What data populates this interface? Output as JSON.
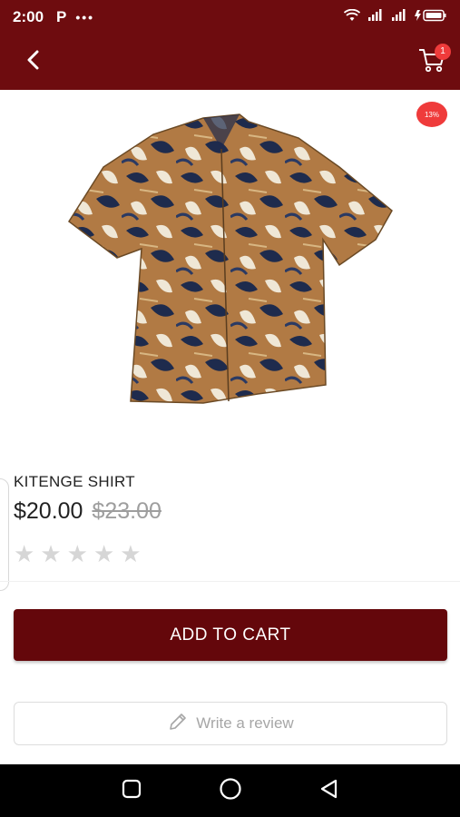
{
  "status_bar": {
    "time": "2:00",
    "app_letter": "P",
    "dots": "•••",
    "icons": [
      "wifi-icon",
      "signal-icon",
      "signal-icon",
      "battery-charging-icon"
    ]
  },
  "app_bar": {
    "back_icon": "chevron-left-icon",
    "cart_icon": "cart-icon",
    "cart_count": "1",
    "background": "#6e0c0f"
  },
  "product": {
    "image_alt": "shirt-image",
    "discount_badge": "13%",
    "name": "KITENGE SHIRT",
    "price": "$20.00",
    "old_price": "$23.00",
    "rating": 0,
    "max_rating": 5
  },
  "actions": {
    "add_to_cart_label": "ADD TO CART",
    "add_to_cart_color": "#64070b",
    "write_review_label": "Write a review",
    "write_review_icon": "pencil-icon"
  },
  "nav_bar": {
    "buttons": [
      "recent-apps-icon",
      "home-icon",
      "back-triangle-icon"
    ]
  }
}
